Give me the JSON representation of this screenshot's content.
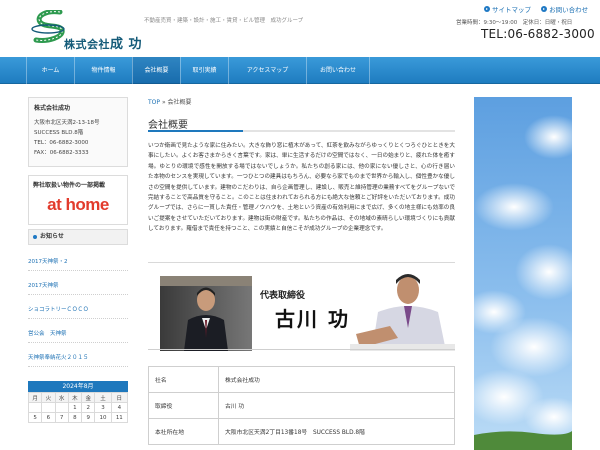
{
  "header": {
    "logo_company": "株式会社",
    "logo_name": "成 功",
    "tagline": "不動産売買・建築・設計・施工・賃貸・ビル管理　成功グループ",
    "utility": [
      {
        "label": "サイトマップ"
      },
      {
        "label": "お問い合わせ"
      }
    ],
    "hours": "営業時間：9:30～19:00　定休日：日曜・祝日",
    "tel": "TEL:06-6882-3000"
  },
  "nav": {
    "items": [
      {
        "label": "ホーム",
        "active": false
      },
      {
        "label": "物件情報",
        "active": false
      },
      {
        "label": "会社概要",
        "active": true
      },
      {
        "label": "取引実績",
        "active": false
      },
      {
        "label": "アクセスマップ",
        "active": false
      },
      {
        "label": "お問い合わせ",
        "active": false
      }
    ]
  },
  "sidebar": {
    "company": {
      "name": "株式会社成功",
      "address": "大阪市北区天満2-13-18号",
      "building": "SUCCESS BLD.8階",
      "tel": "TEL：06-6882-3000",
      "fax": "FAX：06-6882-3333"
    },
    "listing": {
      "title": "弊社取扱い物件の一部掲載",
      "logo_text": "at home"
    },
    "notice": {
      "heading": "お知らせ",
      "items": [
        {
          "label": "2017天神祭・2"
        },
        {
          "label": "2017天神祭"
        },
        {
          "label": "ショコラトリーＣＯＣＯ"
        },
        {
          "label": "営公会　天神祭"
        },
        {
          "label": "天神祭奉納花火２０１５"
        }
      ]
    },
    "calendar": {
      "title": "2024年8月",
      "weekdays": [
        "月",
        "火",
        "水",
        "木",
        "金",
        "土",
        "日"
      ],
      "rows": [
        [
          "",
          "",
          "",
          "1",
          "2",
          "3",
          "4"
        ],
        [
          "5",
          "6",
          "7",
          "8",
          "9",
          "10",
          "11"
        ]
      ]
    }
  },
  "main": {
    "breadcrumb_home": "TOP",
    "breadcrumb_sep": "»",
    "breadcrumb_current": "会社概要",
    "title": "会社概要",
    "intro": "いつか衛画で見たような家に住みたい。大きな飾り窓に植木があって、紅茶を飲みながらゆっくりとくつろぐひとときを大事にしたい。よくお客さまからきく言葉です。家は、単に生活するだけの空間ではなく、一日の始まりと、疲れた体を癒す場。ゆとりの環境で感性を開放する場ではないでしょうか。私たちの創る家には、他の家にない優しさと、心の行き届いた本物のセンスを実現しています。一つひとつの建具はもちろん、必要なら家でものまで世界から輸入し、個性豊かな優しさの空間を提供しています。建物のこだわりは、自ら企画管理し、建設し、販売と維持管理の業務すべてをグループないで完結することで高品質を守ること。このことは住まわれておられる方にも絶大な信頼とご好評をいただいております。成功グループでは、さらに一貫した責任・管理ノウハウを、土地という資産の有効利用にまで広げ、多くの地主様にも効率の良いご提案をさせていただいております。建物は街の財産です。私たちの作品は、その地域の素晴らしい環境づくりにも貢献しております。羅借まで責任を持つこと、この実績と自信こそが成功グループの企業理念です。",
    "ceo_title": "代表取締役",
    "ceo_name": "古川 功",
    "info_rows": [
      {
        "label": "社名",
        "value": "株式会社成功"
      },
      {
        "label": "取締役",
        "value": "古川 功"
      },
      {
        "label": "本社所在地",
        "value": "大阪市北区天満2丁目13番18号　SUCCESS BLD.8階"
      }
    ]
  },
  "colors": {
    "nav_blue": "#1e7cc0",
    "link_blue": "#1a6fb3",
    "brand_green": "#3aa05a",
    "athome_red": "#e23b2c"
  }
}
